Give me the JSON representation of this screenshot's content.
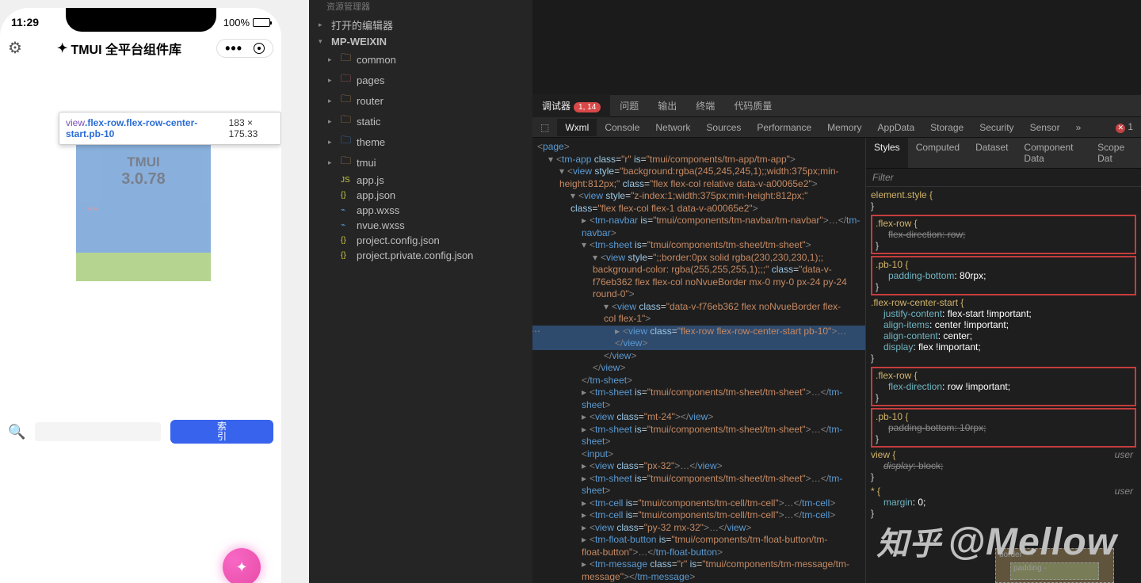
{
  "phone": {
    "time": "11:29",
    "battery_pct": "100%",
    "title": "TMUI 全平台组件库",
    "inspect_selector_prefix": "view",
    "inspect_selector_classes": ".flex-row.flex-row-center-start.pb-10",
    "inspect_dims": "183 × 175.33",
    "card_title": "TMUI",
    "card_version": "3.0.78",
    "tag_button": "索\n引",
    "fab_icon": "✦"
  },
  "explorer": {
    "header": "资源管理器",
    "sections": {
      "open_editors": "打开的编辑器",
      "root": "MP-WEIXIN"
    },
    "folders": [
      "common",
      "pages",
      "router",
      "static",
      "theme",
      "tmui"
    ],
    "files": [
      "app.js",
      "app.json",
      "app.wxss",
      "nvue.wxss",
      "project.config.json",
      "project.private.config.json"
    ]
  },
  "devtools": {
    "top_tabs": {
      "debugger": "调试器",
      "issues": "问题",
      "output": "输出",
      "terminal": "终端",
      "quality": "代码质量"
    },
    "badge": "1, 14",
    "sub_tabs": [
      "Wxml",
      "Console",
      "Network",
      "Sources",
      "Performance",
      "Memory",
      "AppData",
      "Storage",
      "Security",
      "Sensor"
    ],
    "err_count": "1",
    "style_tabs": [
      "Styles",
      "Computed",
      "Dataset",
      "Component Data",
      "Scope Dat"
    ],
    "filter": "Filter",
    "element_style": "element.style {",
    "close": "}",
    "rules": [
      {
        "sel": ".flex-row {",
        "props": [
          {
            "k": "flex-direction",
            "v": ": row;",
            "struck": true
          }
        ],
        "box": true
      },
      {
        "sel": ".pb-10 {",
        "props": [
          {
            "k": "padding-bottom",
            "v": ": 80rpx;"
          }
        ],
        "box": true
      },
      {
        "sel": ".flex-row-center-start {",
        "props": [
          {
            "k": "justify-content",
            "v": ": flex-start !important;"
          },
          {
            "k": "align-items",
            "v": ": center !important;"
          },
          {
            "k": "align-content",
            "v": ": center;"
          },
          {
            "k": "display",
            "v": ": flex !important;"
          }
        ]
      },
      {
        "sel": ".flex-row {",
        "props": [
          {
            "k": "flex-direction",
            "v": ": row !important;"
          }
        ],
        "box": true
      },
      {
        "sel": ".pb-10 {",
        "props": [
          {
            "k": "padding-bottom",
            "v": ": 10rpx;",
            "struck": true
          }
        ],
        "box": true
      },
      {
        "sel": "view {",
        "props": [
          {
            "k": "display",
            "v": ": block;",
            "struck": true,
            "italic": true
          }
        ],
        "usr": "user"
      },
      {
        "sel": "* {",
        "props": [
          {
            "k": "margin",
            "v": ": 0;"
          }
        ],
        "usr": "user"
      }
    ],
    "boxlabels": {
      "border": "border",
      "dash": "-",
      "padding": "padding -"
    }
  },
  "dom": {
    "lines": [
      {
        "i": 0,
        "html": "<span class='t-punc'>&lt;</span><span class='t-tag'>page</span><span class='t-punc'>&gt;</span>"
      },
      {
        "i": 1,
        "arrow": "▾",
        "html": "<span class='t-punc'>&lt;</span><span class='t-tag'>tm-app</span> <span class='t-attr'>class</span>=<span class='t-val'>\"r\"</span> <span class='t-attr'>is</span>=<span class='t-val'>\"tmui/components/tm-app/tm-app\"</span><span class='t-punc'>&gt;</span>"
      },
      {
        "i": 2,
        "arrow": "▾",
        "html": "<span class='t-punc'>&lt;</span><span class='t-tag'>view</span> <span class='t-attr'>style</span>=<span class='t-val'>\"background:rgba(245,245,245,1);;width:375px;min-</span>"
      },
      {
        "i": 2,
        "html": "<span class='t-val'>height:812px;\"</span> <span class='t-attr'>class</span>=<span class='t-val'>\"flex flex-col relative data-v-a00065e2\"</span><span class='t-punc'>&gt;</span>"
      },
      {
        "i": 3,
        "arrow": "▾",
        "html": "<span class='t-punc'>&lt;</span><span class='t-tag'>view</span> <span class='t-attr'>style</span>=<span class='t-val'>\"z-index:1;width:375px;min-height:812px;\"</span>"
      },
      {
        "i": 3,
        "html": "<span class='t-attr'>class</span>=<span class='t-val'>\"flex flex-col flex-1 data-v-a00065e2\"</span><span class='t-punc'>&gt;</span>"
      },
      {
        "i": 4,
        "arrow": "▸",
        "html": "<span class='t-punc'>&lt;</span><span class='t-tag'>tm-navbar</span> <span class='t-attr'>is</span>=<span class='t-val'>\"tmui/components/tm-navbar/tm-navbar\"</span><span class='t-punc'>&gt;</span><span class='ellips'>…</span><span class='t-punc'>&lt;/</span><span class='t-tag'>tm-</span>"
      },
      {
        "i": 4,
        "html": "<span class='t-tag'>navbar</span><span class='t-punc'>&gt;</span>"
      },
      {
        "i": 4,
        "arrow": "▾",
        "html": "<span class='t-punc'>&lt;</span><span class='t-tag'>tm-sheet</span> <span class='t-attr'>is</span>=<span class='t-val'>\"tmui/components/tm-sheet/tm-sheet\"</span><span class='t-punc'>&gt;</span>"
      },
      {
        "i": 5,
        "arrow": "▾",
        "html": "<span class='t-punc'>&lt;</span><span class='t-tag'>view</span> <span class='t-attr'>style</span>=<span class='t-val'>\";;border:0px solid rgba(230,230,230,1);;</span>"
      },
      {
        "i": 5,
        "html": "<span class='t-val'>background-color: rgba(255,255,255,1);;;\"</span> <span class='t-attr'>class</span>=<span class='t-val'>\"data-v-</span>"
      },
      {
        "i": 5,
        "html": "<span class='t-val'>f76eb362 flex flex-col noNvueBorder mx-0 my-0 px-24 py-24</span>"
      },
      {
        "i": 5,
        "html": "<span class='t-val'>round-0\"</span><span class='t-punc'>&gt;</span>"
      },
      {
        "i": 6,
        "arrow": "▾",
        "html": "<span class='t-punc'>&lt;</span><span class='t-tag'>view</span> <span class='t-attr'>class</span>=<span class='t-val'>\"data-v-f76eb362 flex noNvueBorder flex-</span>"
      },
      {
        "i": 6,
        "html": "<span class='t-val'>col flex-1\"</span><span class='t-punc'>&gt;</span>"
      },
      {
        "i": 7,
        "arrow": "▸",
        "sel": true,
        "dots": true,
        "html": "<span class='t-punc'>&lt;</span><span class='t-tag'>view</span> <span class='t-attr'>class</span>=<span class='t-val'>\"flex-row flex-row-center-start pb-10\"</span><span class='t-punc'>&gt;</span><span class='ellips'>…</span>"
      },
      {
        "i": 7,
        "sel": true,
        "html": "<span class='t-punc'>&lt;/</span><span class='t-tag'>view</span><span class='t-punc'>&gt;</span>"
      },
      {
        "i": 6,
        "html": "<span class='t-punc'>&lt;/</span><span class='t-tag'>view</span><span class='t-punc'>&gt;</span>"
      },
      {
        "i": 5,
        "html": "<span class='t-punc'>&lt;/</span><span class='t-tag'>view</span><span class='t-punc'>&gt;</span>"
      },
      {
        "i": 4,
        "html": "<span class='t-punc'>&lt;/</span><span class='t-tag'>tm-sheet</span><span class='t-punc'>&gt;</span>"
      },
      {
        "i": 4,
        "arrow": "▸",
        "html": "<span class='t-punc'>&lt;</span><span class='t-tag'>tm-sheet</span> <span class='t-attr'>is</span>=<span class='t-val'>\"tmui/components/tm-sheet/tm-sheet\"</span><span class='t-punc'>&gt;</span><span class='ellips'>…</span><span class='t-punc'>&lt;/</span><span class='t-tag'>tm-</span>"
      },
      {
        "i": 4,
        "html": "<span class='t-tag'>sheet</span><span class='t-punc'>&gt;</span>"
      },
      {
        "i": 4,
        "arrow": "▸",
        "html": "<span class='t-punc'>&lt;</span><span class='t-tag'>view</span> <span class='t-attr'>class</span>=<span class='t-val'>\"mt-24\"</span><span class='t-punc'>&gt;&lt;/</span><span class='t-tag'>view</span><span class='t-punc'>&gt;</span>"
      },
      {
        "i": 4,
        "arrow": "▸",
        "html": "<span class='t-punc'>&lt;</span><span class='t-tag'>tm-sheet</span> <span class='t-attr'>is</span>=<span class='t-val'>\"tmui/components/tm-sheet/tm-sheet\"</span><span class='t-punc'>&gt;</span><span class='ellips'>…</span><span class='t-punc'>&lt;/</span><span class='t-tag'>tm-</span>"
      },
      {
        "i": 4,
        "html": "<span class='t-tag'>sheet</span><span class='t-punc'>&gt;</span>"
      },
      {
        "i": 4,
        "html": "<span class='t-punc'>&lt;</span><span class='t-tag'>input</span><span class='t-punc'>&gt;</span>"
      },
      {
        "i": 4,
        "arrow": "▸",
        "html": "<span class='t-punc'>&lt;</span><span class='t-tag'>view</span> <span class='t-attr'>class</span>=<span class='t-val'>\"px-32\"</span><span class='t-punc'>&gt;</span><span class='ellips'>…</span><span class='t-punc'>&lt;/</span><span class='t-tag'>view</span><span class='t-punc'>&gt;</span>"
      },
      {
        "i": 4,
        "arrow": "▸",
        "html": "<span class='t-punc'>&lt;</span><span class='t-tag'>tm-sheet</span> <span class='t-attr'>is</span>=<span class='t-val'>\"tmui/components/tm-sheet/tm-sheet\"</span><span class='t-punc'>&gt;</span><span class='ellips'>…</span><span class='t-punc'>&lt;/</span><span class='t-tag'>tm-</span>"
      },
      {
        "i": 4,
        "html": "<span class='t-tag'>sheet</span><span class='t-punc'>&gt;</span>"
      },
      {
        "i": 4,
        "arrow": "▸",
        "html": "<span class='t-punc'>&lt;</span><span class='t-tag'>tm-cell</span> <span class='t-attr'>is</span>=<span class='t-val'>\"tmui/components/tm-cell/tm-cell\"</span><span class='t-punc'>&gt;</span><span class='ellips'>…</span><span class='t-punc'>&lt;/</span><span class='t-tag'>tm-cell</span><span class='t-punc'>&gt;</span>"
      },
      {
        "i": 4,
        "arrow": "▸",
        "html": "<span class='t-punc'>&lt;</span><span class='t-tag'>tm-cell</span> <span class='t-attr'>is</span>=<span class='t-val'>\"tmui/components/tm-cell/tm-cell\"</span><span class='t-punc'>&gt;</span><span class='ellips'>…</span><span class='t-punc'>&lt;/</span><span class='t-tag'>tm-cell</span><span class='t-punc'>&gt;</span>"
      },
      {
        "i": 4,
        "arrow": "▸",
        "html": "<span class='t-punc'>&lt;</span><span class='t-tag'>view</span> <span class='t-attr'>class</span>=<span class='t-val'>\"py-32 mx-32\"</span><span class='t-punc'>&gt;</span><span class='ellips'>…</span><span class='t-punc'>&lt;/</span><span class='t-tag'>view</span><span class='t-punc'>&gt;</span>"
      },
      {
        "i": 4,
        "arrow": "▸",
        "html": "<span class='t-punc'>&lt;</span><span class='t-tag'>tm-float-button</span> <span class='t-attr'>is</span>=<span class='t-val'>\"tmui/components/tm-float-button/tm-</span>"
      },
      {
        "i": 4,
        "html": "<span class='t-val'>float-button\"</span><span class='t-punc'>&gt;</span><span class='ellips'>…</span><span class='t-punc'>&lt;/</span><span class='t-tag'>tm-float-button</span><span class='t-punc'>&gt;</span>"
      },
      {
        "i": 4,
        "arrow": "▸",
        "html": "<span class='t-punc'>&lt;</span><span class='t-tag'>tm-message</span> <span class='t-attr'>class</span>=<span class='t-val'>\"r\"</span> <span class='t-attr'>is</span>=<span class='t-val'>\"tmui/components/tm-message/tm-</span>"
      },
      {
        "i": 4,
        "html": "<span class='t-val'>message\"</span><span class='t-punc'>&gt;&lt;/</span><span class='t-tag'>tm-message</span><span class='t-punc'>&gt;</span>"
      }
    ]
  },
  "watermark": "知乎 @Mellow"
}
